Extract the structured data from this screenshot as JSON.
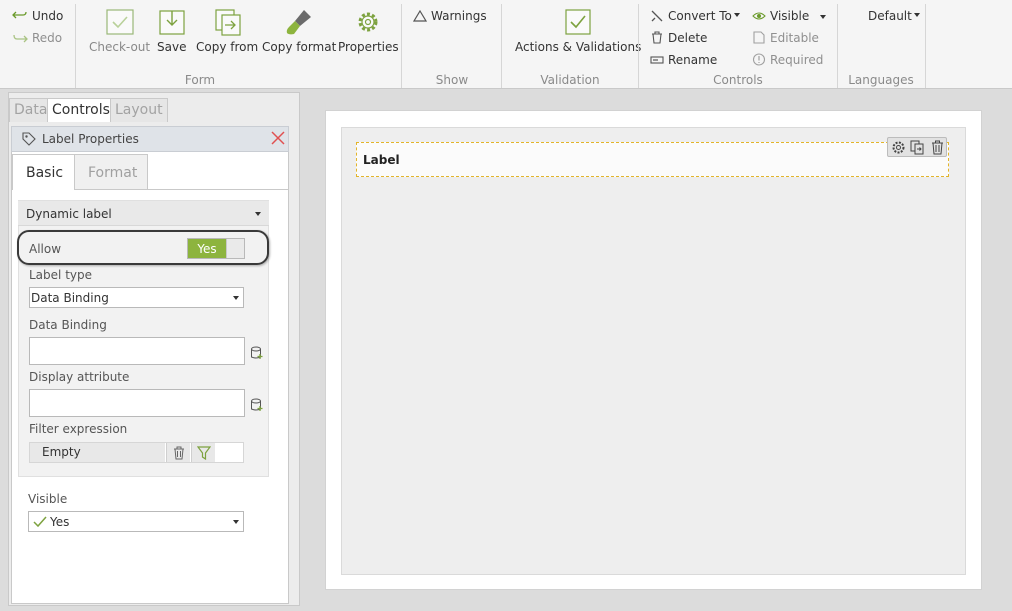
{
  "ribbon": {
    "undo": "Undo",
    "redo": "Redo",
    "form": {
      "checkout": "Check-out",
      "save": "Save",
      "copy_from": "Copy from",
      "copy_format": "Copy format",
      "properties": "Properties",
      "group_label": "Form"
    },
    "show": {
      "warnings": "Warnings",
      "group_label": "Show"
    },
    "validation": {
      "actions": "Actions & Validations",
      "group_label": "Validation"
    },
    "controls": {
      "convert_to": "Convert To",
      "delete": "Delete",
      "rename": "Rename",
      "visible": "Visible",
      "editable": "Editable",
      "required": "Required",
      "group_label": "Controls"
    },
    "languages": {
      "selected": "Default",
      "group_label": "Languages"
    }
  },
  "left_panel": {
    "tabs": [
      "Data",
      "Controls",
      "Layout"
    ],
    "active_tab": "Controls",
    "properties_title": "Label Properties",
    "subtabs": [
      "Basic",
      "Format"
    ],
    "dynamic_label": {
      "header": "Dynamic label",
      "allow_label": "Allow",
      "allow_value": "Yes",
      "label_type_label": "Label type",
      "label_type_value": "Data Binding",
      "data_binding_label": "Data Binding",
      "data_binding_value": "",
      "display_attribute_label": "Display attribute",
      "display_attribute_value": "",
      "filter_expression_label": "Filter expression",
      "filter_expression_value": "Empty"
    },
    "visible": {
      "label": "Visible",
      "value": "Yes"
    }
  },
  "canvas": {
    "label_control": "Label"
  },
  "colors": {
    "accent_green": "#8db43e",
    "close_red": "#e05050",
    "selection_border": "#e3b52a"
  }
}
